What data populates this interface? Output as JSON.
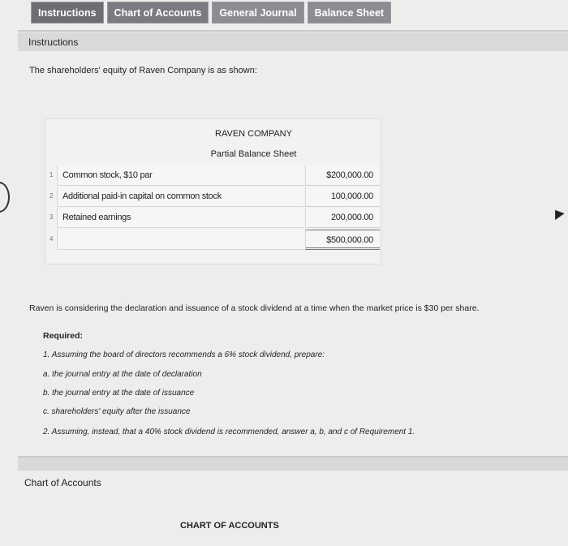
{
  "tabs": [
    {
      "label": "Instructions"
    },
    {
      "label": "Chart of Accounts"
    },
    {
      "label": "General Journal"
    },
    {
      "label": "Balance Sheet"
    }
  ],
  "instructions_header": "Instructions",
  "intro": "The shareholders' equity of Raven Company is as shown:",
  "balance_sheet": {
    "company": "RAVEN COMPANY",
    "title": "Partial Balance Sheet",
    "rows": [
      {
        "num": "1",
        "label": "Common stock, $10 par",
        "amount": "$200,000.00"
      },
      {
        "num": "2",
        "label": "Additional paid-in capital on common stock",
        "amount": "100,000.00"
      },
      {
        "num": "3",
        "label": "Retained earnings",
        "amount": "200,000.00"
      },
      {
        "num": "4",
        "label": "",
        "amount": "$500,000.00"
      }
    ]
  },
  "paragraph": "Raven is considering the declaration and issuance of a stock dividend at a time when the market price is $30 per share.",
  "required": {
    "heading": "Required:",
    "item1": "1.  Assuming the board of directors recommends a 6% stock dividend, prepare:",
    "a": "a.  the journal entry at the date of declaration",
    "b": "b.  the journal entry at the date of issuance",
    "c": "c.  shareholders' equity after the issuance",
    "item2": "2.  Assuming, instead, that a 40% stock dividend is recommended, answer a, b, and c of Requirement 1."
  },
  "chart_of_accounts": {
    "label": "Chart of Accounts",
    "title": "CHART OF ACCOUNTS"
  }
}
